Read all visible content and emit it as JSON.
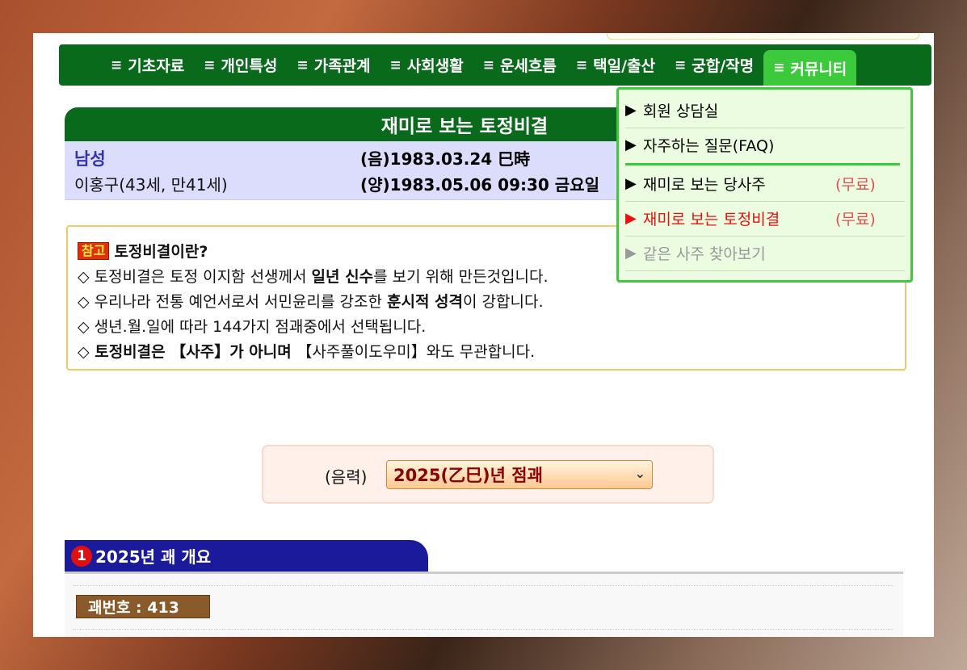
{
  "nav": {
    "items": [
      {
        "label": "기초자료"
      },
      {
        "label": "개인특성"
      },
      {
        "label": "가족관계"
      },
      {
        "label": "사회생활"
      },
      {
        "label": "운세흐름"
      },
      {
        "label": "택일/출산"
      },
      {
        "label": "궁합/작명"
      },
      {
        "label": "커뮤니티"
      }
    ],
    "menu_glyph": "≡"
  },
  "title": "재미로 보는 토정비결",
  "profile": {
    "gender": "남성",
    "name": "이홍구(43세, 만41세)",
    "lunar": "(음)1983.03.24 巳時",
    "solar": "(양)1983.05.06 09:30 금요일"
  },
  "note": {
    "badge": "참고",
    "title": "토정비결이란?",
    "line1_a": "◇ 토정비결은 토정 이지함 선생께서 ",
    "line1_b": "일년 신수",
    "line1_c": "를 보기 위해 만든것입니다.",
    "line2_a": "◇ 우리나라 전통 예언서로서 서민윤리를 강조한 ",
    "line2_b": "훈시적 성격",
    "line2_c": "이 강합니다.",
    "line3": "◇ 생년.월.일에 따라 144가지 점괘중에서 선택됩니다.",
    "line4_a": "◇ 토정비결은 【사주】가 아니며 ",
    "line4_b": "【사주풀이도우미】와도 무관합니다."
  },
  "selector": {
    "label": "(음력)",
    "value": "2025(乙巳)년 점괘",
    "arrow": "⌄"
  },
  "section": {
    "number": "1",
    "title": "2025년 괘 개요",
    "gwe_label": "괘번호 : 413"
  },
  "dropdown": {
    "items": [
      {
        "label": "회원 상담실",
        "free": "",
        "state": "normal"
      },
      {
        "label": "자주하는 질문(FAQ)",
        "free": "",
        "state": "normal"
      },
      {
        "label": "재미로 보는 당사주",
        "free": "(무료)",
        "state": "normal"
      },
      {
        "label": "재미로 보는 토정비결",
        "free": "(무료)",
        "state": "current"
      },
      {
        "label": "같은 사주 찾아보기",
        "free": "",
        "state": "disabled"
      }
    ],
    "tri": "▶"
  },
  "colors": {
    "nav_bg": "#0a6a1c",
    "nav_active": "#3cc93c",
    "section_bg": "#1a1a9a",
    "current_item": "#e81010",
    "disabled_item": "#999999"
  }
}
